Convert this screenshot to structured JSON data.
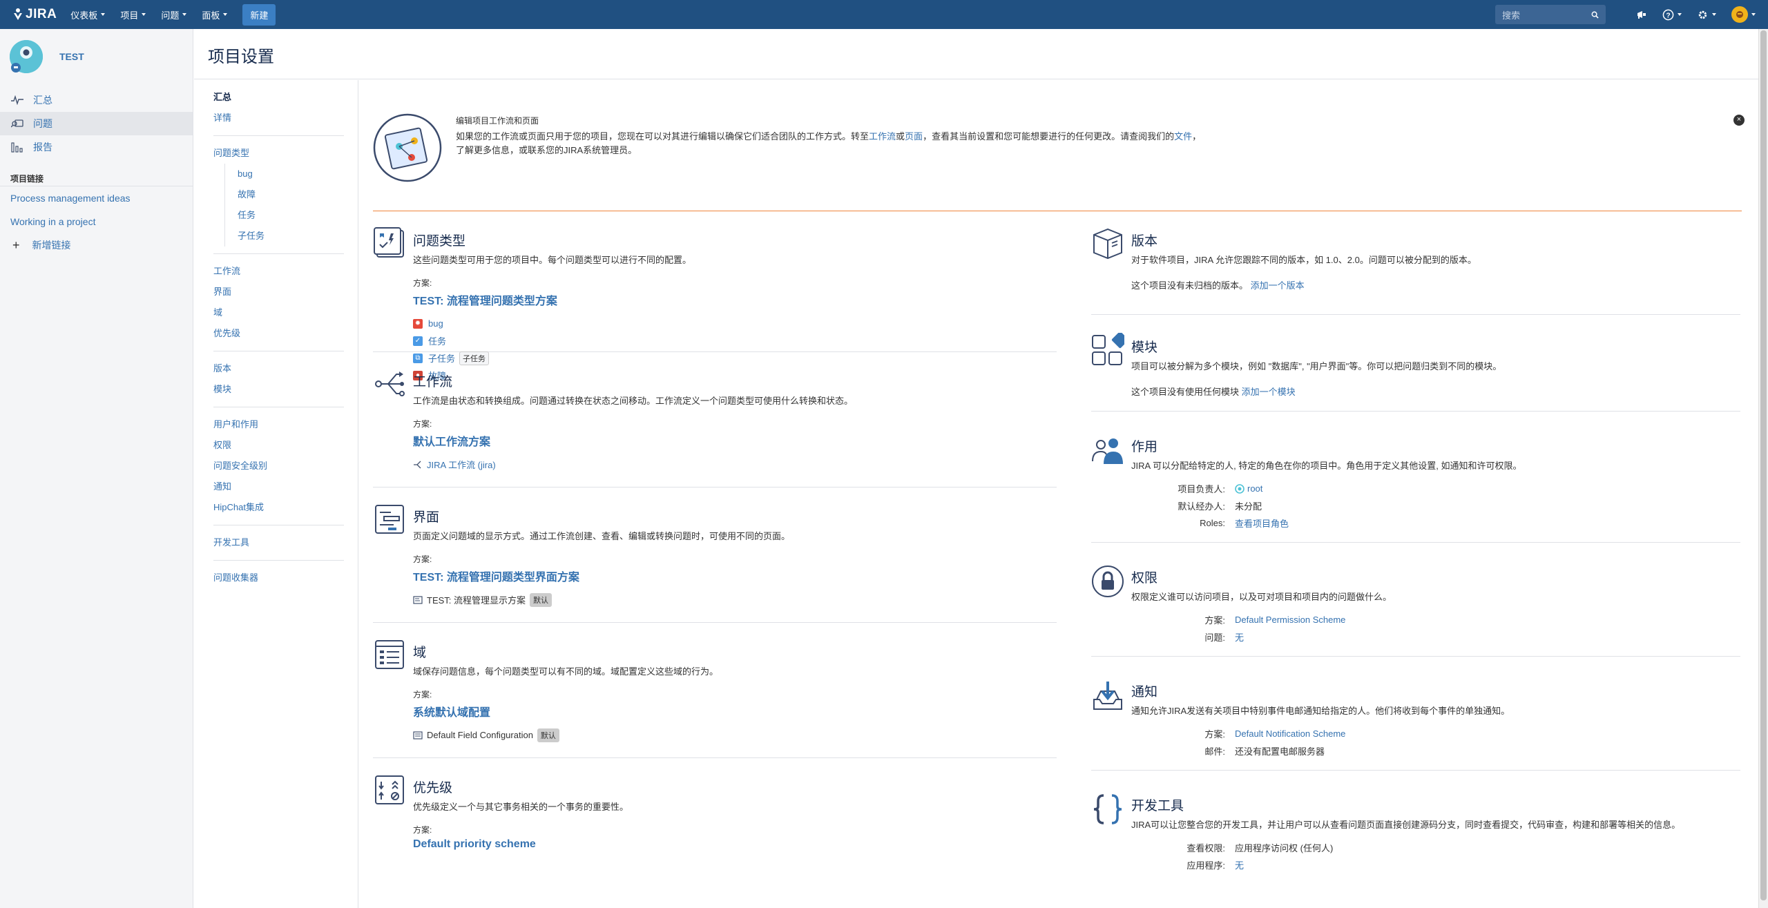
{
  "topbar": {
    "logo": "JIRA",
    "nav": [
      "仪表板",
      "项目",
      "问题",
      "面板"
    ],
    "create": "新建",
    "search_placeholder": "搜索"
  },
  "sidebar": {
    "project_name": "TEST",
    "items": [
      {
        "label": "汇总",
        "icon": "pulse-icon"
      },
      {
        "label": "问题",
        "icon": "issues-icon"
      },
      {
        "label": "报告",
        "icon": "reports-icon"
      }
    ],
    "links_header": "项目链接",
    "links": [
      "Process management ideas",
      "Working in a project"
    ],
    "add_link": "新增链接"
  },
  "header": {
    "title": "项目设置"
  },
  "settings_nav": {
    "groups": [
      [
        "汇总",
        "详情"
      ],
      [
        "问题类型"
      ],
      [
        "工作流",
        "界面",
        "域",
        "优先级"
      ],
      [
        "版本",
        "模块"
      ],
      [
        "用户和作用",
        "权限",
        "问题安全级别",
        "通知",
        "HipChat集成"
      ],
      [
        "开发工具"
      ],
      [
        "问题收集器"
      ]
    ],
    "issue_types": [
      "bug",
      "故障",
      "任务",
      "子任务"
    ]
  },
  "banner": {
    "title": "编辑项目工作流和页面",
    "text1": "如果您的工作流或页面只用于您的项目，您现在可以对其进行编辑以确保它们适合团队的工作方式。转至",
    "link1": "工作流",
    "text2": "或",
    "link2": "页面",
    "text3": "，查看其当前设置和您可能想要进行的任何更改。请查阅我们的",
    "link3": "文件",
    "text4": "，",
    "text5": "了解更多信息，或联系您的JIRA系统管理员。",
    "close": "×"
  },
  "left": {
    "issue_types": {
      "title": "问题类型",
      "desc": "这些问题类型可用于您的项目中。每个问题类型可以进行不同的配置。",
      "scheme_label": "方案:",
      "scheme": "TEST: 流程管理问题类型方案",
      "items": [
        {
          "name": "bug",
          "color": "#e5493a"
        },
        {
          "name": "任务",
          "color": "#4a9ae6"
        },
        {
          "name": "子任务",
          "color": "#4a9ae6",
          "tag": "子任务"
        },
        {
          "name": "故障",
          "color": "#d04437"
        }
      ]
    },
    "workflow": {
      "title": "工作流",
      "desc": "工作流是由状态和转换组成。问题通过转换在状态之间移动。工作流定义一个问题类型可使用什么转换和状态。",
      "scheme_label": "方案:",
      "scheme": "默认工作流方案",
      "item": "JIRA 工作流 (jira)"
    },
    "screens": {
      "title": "界面",
      "desc": "页面定义问题域的显示方式。通过工作流创建、查看、编辑或转换问题时，可使用不同的页面。",
      "scheme_label": "方案:",
      "scheme": "TEST: 流程管理问题类型界面方案",
      "item": "TEST: 流程管理显示方案",
      "tag": "默认"
    },
    "fields": {
      "title": "域",
      "desc": "域保存问题信息，每个问题类型可以有不同的域。域配置定义这些域的行为。",
      "scheme_label": "方案:",
      "scheme": "系统默认域配置",
      "item": "Default Field Configuration",
      "tag": "默认"
    },
    "priorities": {
      "title": "优先级",
      "desc": "优先级定义一个与其它事务相关的一个事务的重要性。",
      "scheme_label": "方案:",
      "scheme": "Default priority scheme"
    }
  },
  "right": {
    "versions": {
      "title": "版本",
      "desc": "对于软件项目，JIRA 允许您跟踪不同的版本，如 1.0、2.0。问题可以被分配到的版本。",
      "note": "这个项目没有未归档的版本。",
      "link": "添加一个版本"
    },
    "components": {
      "title": "模块",
      "desc": "项目可以被分解为多个模块，例如 \"数据库\", \"用户界面\"等。你可以把问题归类到不同的模块。",
      "note": "这个项目没有使用任何模块",
      "link": "添加一个模块"
    },
    "roles": {
      "title": "作用",
      "desc": "JIRA 可以分配给特定的人, 特定的角色在你的项目中。角色用于定义其他设置, 如通知和许可权限。",
      "lead_label": "项目负责人:",
      "lead": "root",
      "assignee_label": "默认经办人:",
      "assignee": "未分配",
      "roles_label": "Roles:",
      "roles_link": "查看项目角色"
    },
    "permissions": {
      "title": "权限",
      "desc": "权限定义谁可以访问项目，以及可对项目和项目内的问题做什么。",
      "scheme_label": "方案:",
      "scheme": "Default Permission Scheme",
      "issues_label": "问题:",
      "issues": "无"
    },
    "notifications": {
      "title": "通知",
      "desc": "通知允许JIRA发送有关项目中特别事件电邮通知给指定的人。他们将收到每个事件的单独通知。",
      "scheme_label": "方案:",
      "scheme": "Default Notification Scheme",
      "mail_label": "邮件:",
      "mail": "还没有配置电邮服务器"
    },
    "devtools": {
      "title": "开发工具",
      "desc": "JIRA可以让您整合您的开发工具，并让用户可以从查看问题页面直接创建源码分支，同时查看提交，代码审查，构建和部署等相关的信息。",
      "view_label": "查看权限:",
      "view": "应用程序访问权 (任何人)",
      "apps_label": "应用程序:",
      "apps": "无"
    }
  }
}
